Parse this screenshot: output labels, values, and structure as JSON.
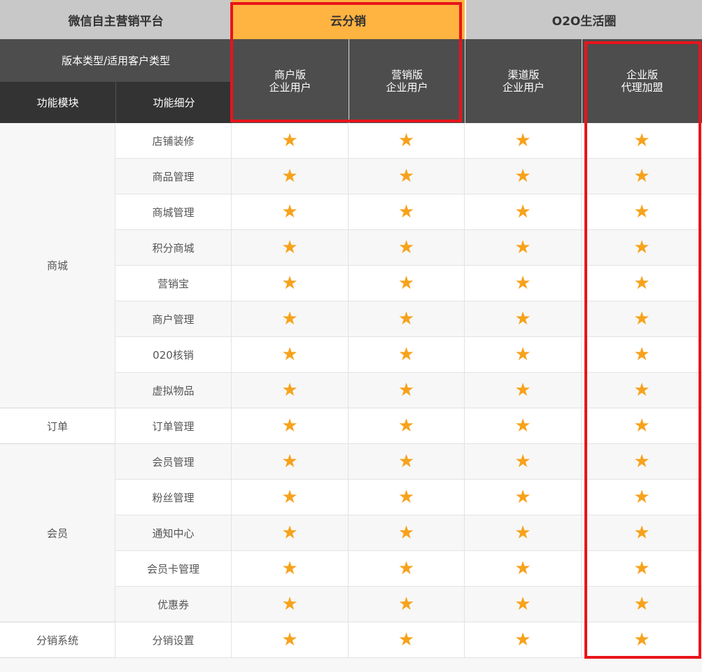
{
  "header": {
    "platform": "微信自主营销平台",
    "group_cloud": "云分销",
    "group_o2o": "O2O生活圈",
    "version_type_label": "版本类型/适用客户类型",
    "module_label": "功能模块",
    "detail_label": "功能细分"
  },
  "versions": [
    {
      "name": "商户版",
      "customer": "企业用户"
    },
    {
      "name": "营销版",
      "customer": "企业用户"
    },
    {
      "name": "渠道版",
      "customer": "企业用户"
    },
    {
      "name": "企业版",
      "customer": "代理加盟"
    }
  ],
  "modules": [
    {
      "name": "商城",
      "rows": 8
    },
    {
      "name": "订单",
      "rows": 1
    },
    {
      "name": "会员",
      "rows": 5
    },
    {
      "name": "分销系统",
      "rows": 1
    }
  ],
  "features": [
    "店铺装修",
    "商品管理",
    "商城管理",
    "积分商城",
    "营销宝",
    "商户管理",
    "020核销",
    "虚拟物品",
    "订单管理",
    "会员管理",
    "粉丝管理",
    "通知中心",
    "会员卡管理",
    "优惠券",
    "分销设置"
  ],
  "star_symbol": "★",
  "colors": {
    "header_light": "#c8c8c8",
    "header_orange": "#ffb340",
    "header_dark": "#4d4d4d",
    "header_darker": "#333333",
    "star": "#f7a21b",
    "highlight_border": "#e8141b",
    "row_alt": "#f7f7f7"
  }
}
